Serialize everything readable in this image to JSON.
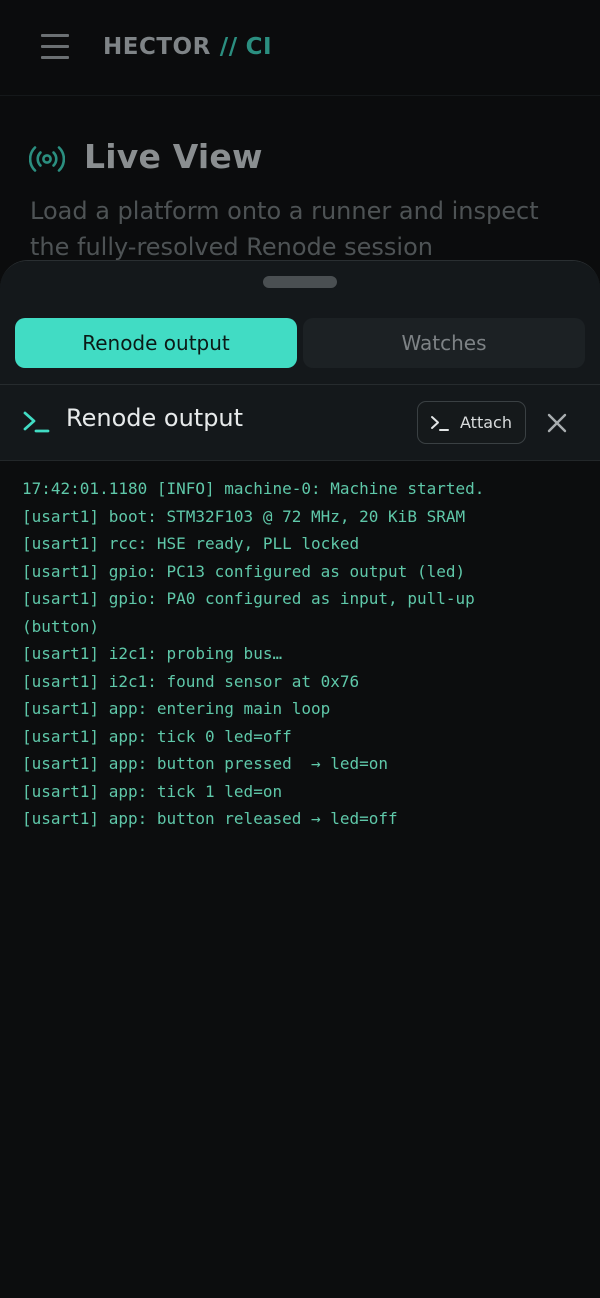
{
  "header": {
    "brand_name": "HECTOR",
    "brand_sep": "//",
    "brand_suffix": "CI",
    "menu_icon": "hamburger-menu-icon"
  },
  "hero": {
    "icon": "live-broadcast-icon",
    "title": "Live View",
    "subtitle": "Load a platform onto a runner and inspect the fully-resolved Renode session"
  },
  "sheet": {
    "tabs": [
      {
        "label": "Renode output",
        "active": true
      },
      {
        "label": "Watches",
        "active": false
      }
    ],
    "panel": {
      "title": "Renode output",
      "title_icon": "terminal-icon",
      "attach_label": "Attach",
      "attach_icon": "terminal-icon",
      "close_icon": "close-icon"
    },
    "console_lines": [
      "17:42:01.1180 [INFO] machine-0: Machine started.",
      "[usart1] boot: STM32F103 @ 72 MHz, 20 KiB SRAM",
      "[usart1] rcc: HSE ready, PLL locked",
      "[usart1] gpio: PC13 configured as output (led)",
      "[usart1] gpio: PA0 configured as input, pull-up",
      "(button)",
      "[usart1] i2c1: probing bus…",
      "[usart1] i2c1: found sensor at 0x76",
      "[usart1] app: entering main loop",
      "[usart1] app: tick 0 led=off",
      "[usart1] app: button pressed  → led=on",
      "[usart1] app: tick 1 led=on",
      "[usart1] app: button released → led=off"
    ]
  },
  "colors": {
    "accent": "#41dcc4",
    "console_text": "#5fc8a9",
    "background": "#0b0c0d"
  }
}
